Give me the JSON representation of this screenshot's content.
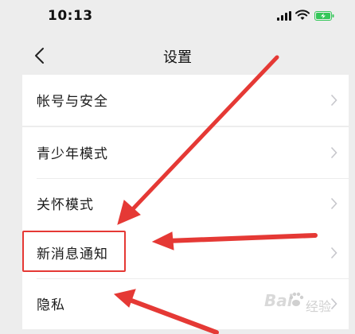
{
  "status_bar": {
    "time": "10:13",
    "battery_color": "#34c759"
  },
  "nav": {
    "title": "设置",
    "back_icon": "chevron-left-icon"
  },
  "settings": {
    "groups": [
      {
        "items": [
          {
            "label": "帐号与安全"
          }
        ]
      },
      {
        "items": [
          {
            "label": "青少年模式"
          },
          {
            "label": "关怀模式"
          }
        ]
      },
      {
        "items": [
          {
            "label": "新消息通知"
          },
          {
            "label": "隐私"
          }
        ]
      }
    ],
    "highlighted_item": "新消息通知"
  },
  "annotation": {
    "arrow_color": "#e53935"
  },
  "watermark": {
    "brand": "Bai",
    "suffix": "经验"
  }
}
